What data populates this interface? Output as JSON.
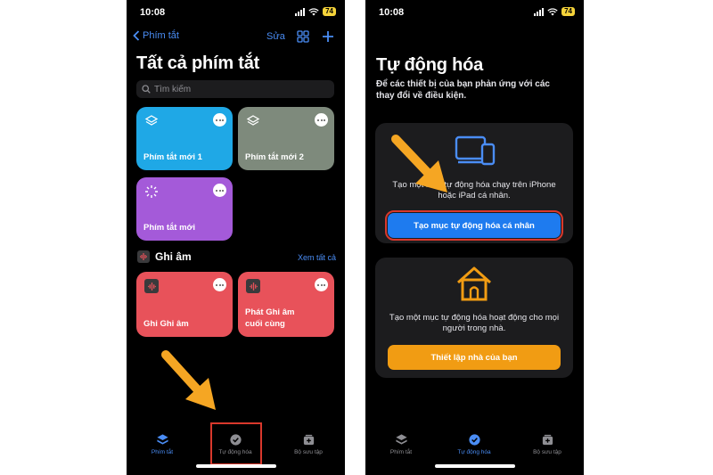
{
  "colors": {
    "accent": "#4a8df5",
    "card_blue": "#1fa8e6",
    "card_gray": "#7e8a7c",
    "card_purple": "#a45ad9",
    "card_red": "#e8525a",
    "highlight": "#d9382c",
    "arrow": "#f5a623"
  },
  "left": {
    "status": {
      "time": "10:08",
      "battery": "74"
    },
    "nav": {
      "back_label": "Phím tắt",
      "edit_label": "Sửa"
    },
    "title": "Tất cả phím tắt",
    "search": {
      "placeholder": "Tìm kiếm"
    },
    "shortcuts": [
      {
        "label": "Phím tắt mới 1",
        "icon": "layers-icon"
      },
      {
        "label": "Phím tắt mới 2",
        "icon": "layers-icon"
      },
      {
        "label": "Phím tắt mới",
        "icon": "sparkle-icon"
      }
    ],
    "section": {
      "title": "Ghi âm",
      "link": "Xem tất cả"
    },
    "recordings": [
      {
        "label": "Ghi Ghi âm"
      },
      {
        "label_line1": "Phát Ghi âm",
        "label_line2": "cuối cùng"
      }
    ],
    "tabs": [
      {
        "label": "Phím tắt",
        "icon": "layers-icon",
        "active": true
      },
      {
        "label": "Tự động hóa",
        "icon": "automation-check-icon",
        "active": false
      },
      {
        "label": "Bộ sưu tập",
        "icon": "gallery-icon",
        "active": false
      }
    ]
  },
  "right": {
    "status": {
      "time": "10:08",
      "battery": "74"
    },
    "title": "Tự động hóa",
    "subtitle_line1": "Để các thiết bị của bạn phản ứng với các",
    "subtitle_line2": "thay đổi về điều kiện.",
    "personal": {
      "desc_line1": "Tạo một mục tự động hóa chạy trên iPhone",
      "desc_line2": "hoặc iPad cá nhân.",
      "button": "Tạo mục tự động hóa cá nhân"
    },
    "home": {
      "desc_line1": "Tạo một mục tự động hóa hoạt động cho mọi",
      "desc_line2": "người trong nhà.",
      "button": "Thiết lập nhà của bạn"
    },
    "tabs": [
      {
        "label": "Phím tắt",
        "icon": "layers-icon",
        "active": false
      },
      {
        "label": "Tự động hóa",
        "icon": "automation-check-icon",
        "active": true
      },
      {
        "label": "Bộ sưu tập",
        "icon": "gallery-icon",
        "active": false
      }
    ]
  }
}
